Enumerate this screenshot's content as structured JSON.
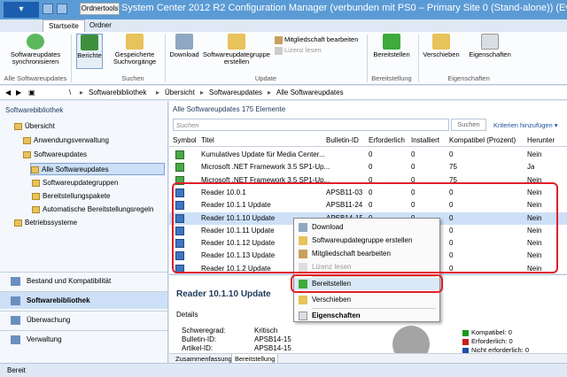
{
  "titlebar": {
    "app_button": "▾",
    "context_tab": "Ordnertools",
    "title": "System Center 2012 R2 Configuration Manager (verbunden mit PS0 – Primary Site 0 (Stand-alone)) (Eva..."
  },
  "ribbon_tabs": [
    "Startseite",
    "Ordner"
  ],
  "ribbon": {
    "sync_label": "Softwareupdates synchronisieren",
    "group_alle": "Alle Softwareupdates",
    "berichte_label": "Berichte",
    "gespeicherte_label": "Gespeicherte Suchvorgänge",
    "group_suchen": "Suchen",
    "download_label": "Download",
    "sw_group_label": "Softwareupdategruppe erstellen",
    "mitglied_label": "Mitgliedschaft bearbeiten",
    "lizenz_label": "Lizenz lesen",
    "group_update": "Update",
    "bereitstellen_label": "Bereitstellen",
    "group_bereitstellung": "Bereitstellung",
    "verschieben_label": "Verschieben",
    "eigenschaften_label": "Eigenschaften",
    "group_eigenschaften": "Eigenschaften"
  },
  "breadcrumb": {
    "root": "\\",
    "parts": [
      "Softwarebibliothek",
      "Übersicht",
      "Softwareupdates",
      "Alle Softwareupdates"
    ]
  },
  "nav": {
    "header": "Softwarebibliothek",
    "tree": [
      "Übersicht",
      "Anwendungsverwaltung",
      "Softwareupdates",
      "Alle Softwareupdates",
      "Softwareupdategruppen",
      "Bereitstellungspakete",
      "Automatische Bereitstellungsregeln",
      "Betriebssysteme"
    ],
    "workspaces": [
      "Bestand und Kompatibilität",
      "Softwarebibliothek",
      "Überwachung",
      "Verwaltung"
    ]
  },
  "main": {
    "header_title": "Alle Softwareupdates",
    "header_count": "175 Elemente",
    "search_placeholder": "Suchen",
    "search_button": "Suchen",
    "add_criteria": "Kriterien hinzufügen",
    "columns": [
      "Symbol",
      "Titel",
      "Bulletin-ID",
      "Erforderlich",
      "Installiert",
      "Kompatibel (Prozent)",
      "Herunter"
    ],
    "rows": [
      {
        "title": "Kumulatives Update für Media Center...",
        "bulletin": "",
        "req": "0",
        "inst": "0",
        "comp": "0",
        "down": "Nein"
      },
      {
        "title": "Microsoft .NET Framework 3.5 SP1-Up...",
        "bulletin": "",
        "req": "0",
        "inst": "0",
        "comp": "75",
        "down": "Ja"
      },
      {
        "title": "Microsoft .NET Framework 3.5 SP1-Up...",
        "bulletin": "",
        "req": "0",
        "inst": "0",
        "comp": "75",
        "down": "Nein"
      },
      {
        "title": "Reader 10.0.1",
        "bulletin": "APSB11-03",
        "req": "0",
        "inst": "0",
        "comp": "0",
        "down": "Nein"
      },
      {
        "title": "Reader 10.1.1 Update",
        "bulletin": "APSB11-24",
        "req": "0",
        "inst": "0",
        "comp": "0",
        "down": "Nein"
      },
      {
        "title": "Reader 10.1.10 Update",
        "bulletin": "APSB14-15",
        "req": "0",
        "inst": "0",
        "comp": "0",
        "down": "Nein"
      },
      {
        "title": "Reader 10.1.11 Update",
        "bulletin": "",
        "req": "",
        "inst": "",
        "comp": "0",
        "down": "Nein"
      },
      {
        "title": "Reader 10.1.12 Update",
        "bulletin": "",
        "req": "",
        "inst": "",
        "comp": "0",
        "down": "Nein"
      },
      {
        "title": "Reader 10.1.13 Update",
        "bulletin": "",
        "req": "",
        "inst": "",
        "comp": "0",
        "down": "Nein"
      },
      {
        "title": "Reader 10.1.2 Update",
        "bulletin": "",
        "req": "",
        "inst": "",
        "comp": "0",
        "down": "Nein"
      }
    ]
  },
  "details": {
    "title": "Reader 10.1.10 Update",
    "section": "Details",
    "kv": [
      {
        "k": "Schweregrad:",
        "v": "Kritisch"
      },
      {
        "k": "Bulletin-ID:",
        "v": "APSB14-15"
      },
      {
        "k": "Artikel-ID:",
        "v": "APSB14-15"
      }
    ],
    "legend": [
      {
        "label": "Kompatibel: 0",
        "color": "#1a9a1a"
      },
      {
        "label": "Erforderlich: 0",
        "color": "#c81e1e"
      },
      {
        "label": "Nicht erforderlich: 0",
        "color": "#1f4ea8"
      }
    ],
    "tabs": [
      "Zusammenfassung",
      "Bereitstellung"
    ]
  },
  "context_menu": {
    "items": [
      "Download",
      "Softwareupdategruppe erstellen",
      "Mitgliedschaft bearbeiten",
      "Lizenz lesen",
      "Bereitstellen",
      "Verschieben",
      "Eigenschaften"
    ]
  },
  "status": "Bereit"
}
